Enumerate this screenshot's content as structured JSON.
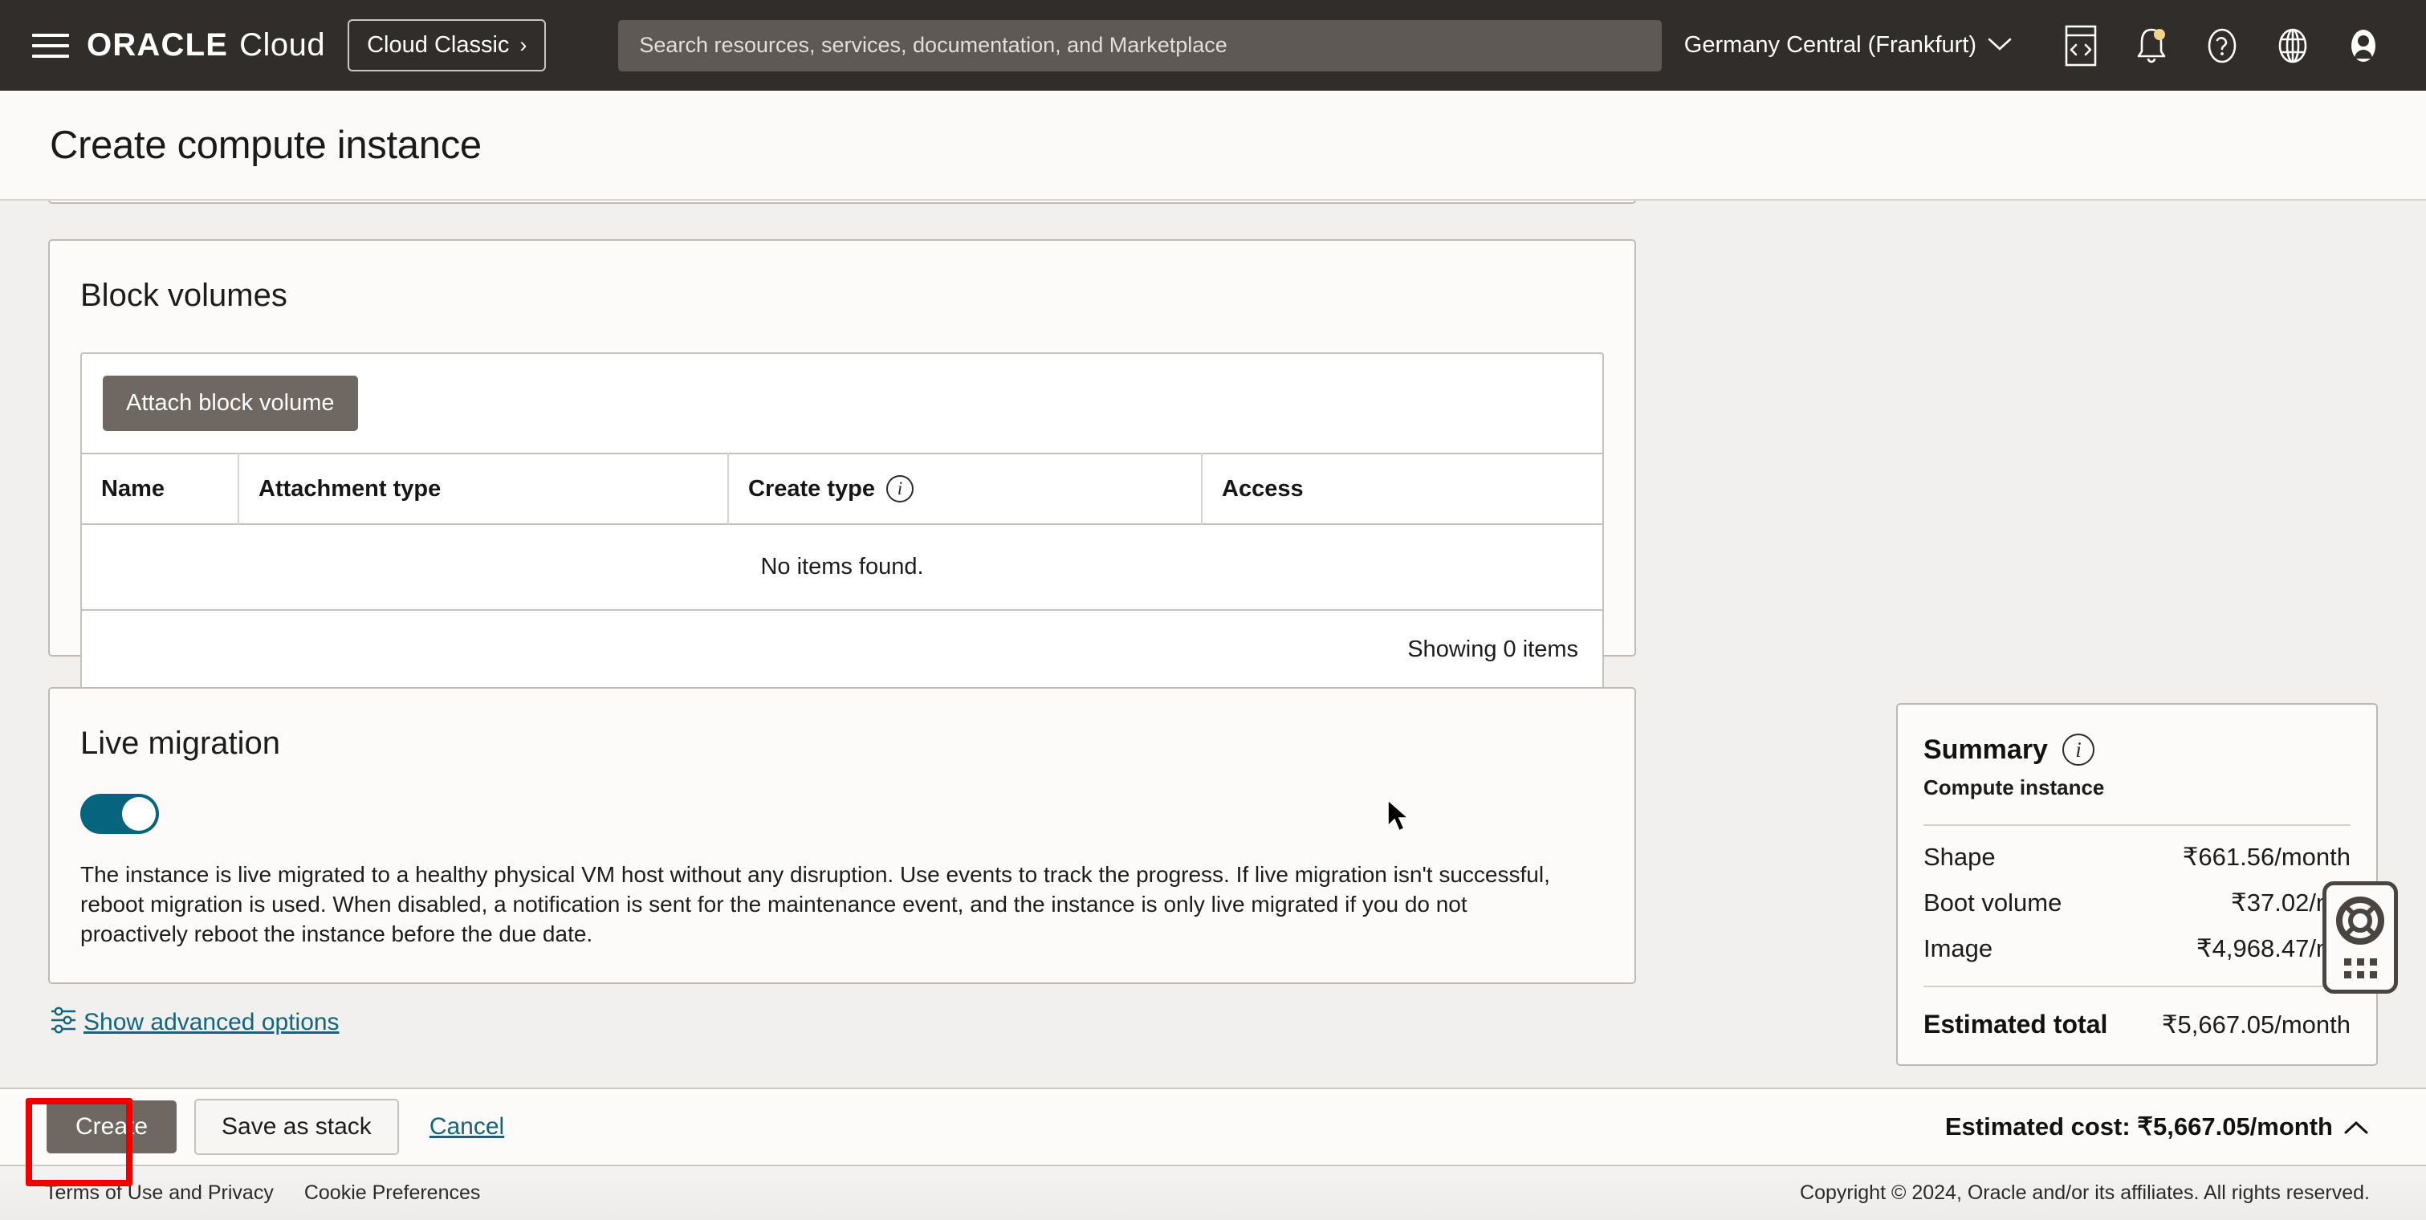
{
  "topbar": {
    "menu_icon": "hamburger-menu-icon",
    "brand_oracle": "ORACLE",
    "brand_cloud": "Cloud",
    "cloud_classic_label": "Cloud Classic",
    "cloud_classic_chevron": "›",
    "search_placeholder": "Search resources, services, documentation, and Marketplace",
    "search_value": "",
    "region": "Germany Central (Frankfurt)",
    "region_chevron": "⌄",
    "icons": [
      "cloud-shell-icon",
      "notifications-bell-icon",
      "help-question-icon",
      "language-globe-icon",
      "user-avatar-icon"
    ],
    "accent_bg": "#312d2a",
    "search_bg": "#5e5955"
  },
  "page": {
    "title": "Create compute instance"
  },
  "block_volumes": {
    "section_title": "Block volumes",
    "attach_button": "Attach block volume",
    "columns": [
      "Name",
      "Attachment type",
      "Create type",
      "Access"
    ],
    "create_type_info_icon": "info-icon",
    "rows": [],
    "empty_text": "No items found.",
    "showing_text": "Showing 0 items"
  },
  "live_migration": {
    "section_title": "Live migration",
    "toggle_enabled": true,
    "toggle_color": "#06647f",
    "description": "The instance is live migrated to a healthy physical VM host without any disruption. Use events to track the progress. If live migration isn't successful, reboot migration is used. When disabled, a notification is sent for the maintenance event, and the instance is only live migrated if you do not proactively reboot the instance before the due date."
  },
  "advanced": {
    "link_label": "Show advanced options",
    "icon": "sliders-icon",
    "link_color": "#12657e"
  },
  "summary": {
    "title": "Summary",
    "info_icon": "info-icon",
    "subtitle": "Compute instance",
    "rows": [
      {
        "label": "Shape",
        "value": "₹661.56/month"
      },
      {
        "label": "Boot volume",
        "value": "₹37.02/mo"
      },
      {
        "label": "Image",
        "value": "₹4,968.47/mo"
      }
    ],
    "total_label": "Estimated total",
    "total_value": "₹5,667.05/month"
  },
  "help_widget": {
    "icon": "lifesaver-help-icon",
    "drag_handle": "dot-grid-drag-handle"
  },
  "actionbar": {
    "create_label": "Create",
    "save_stack_label": "Save as stack",
    "cancel_label": "Cancel",
    "estimated_cost": "Estimated cost: ₹5,667.05/month",
    "estimated_chevron": "⌃",
    "highlight_color": "#ee0000"
  },
  "footer": {
    "terms": "Terms of Use and Privacy",
    "cookies": "Cookie Preferences",
    "copyright": "Copyright © 2024, Oracle and/or its affiliates. All rights reserved."
  }
}
